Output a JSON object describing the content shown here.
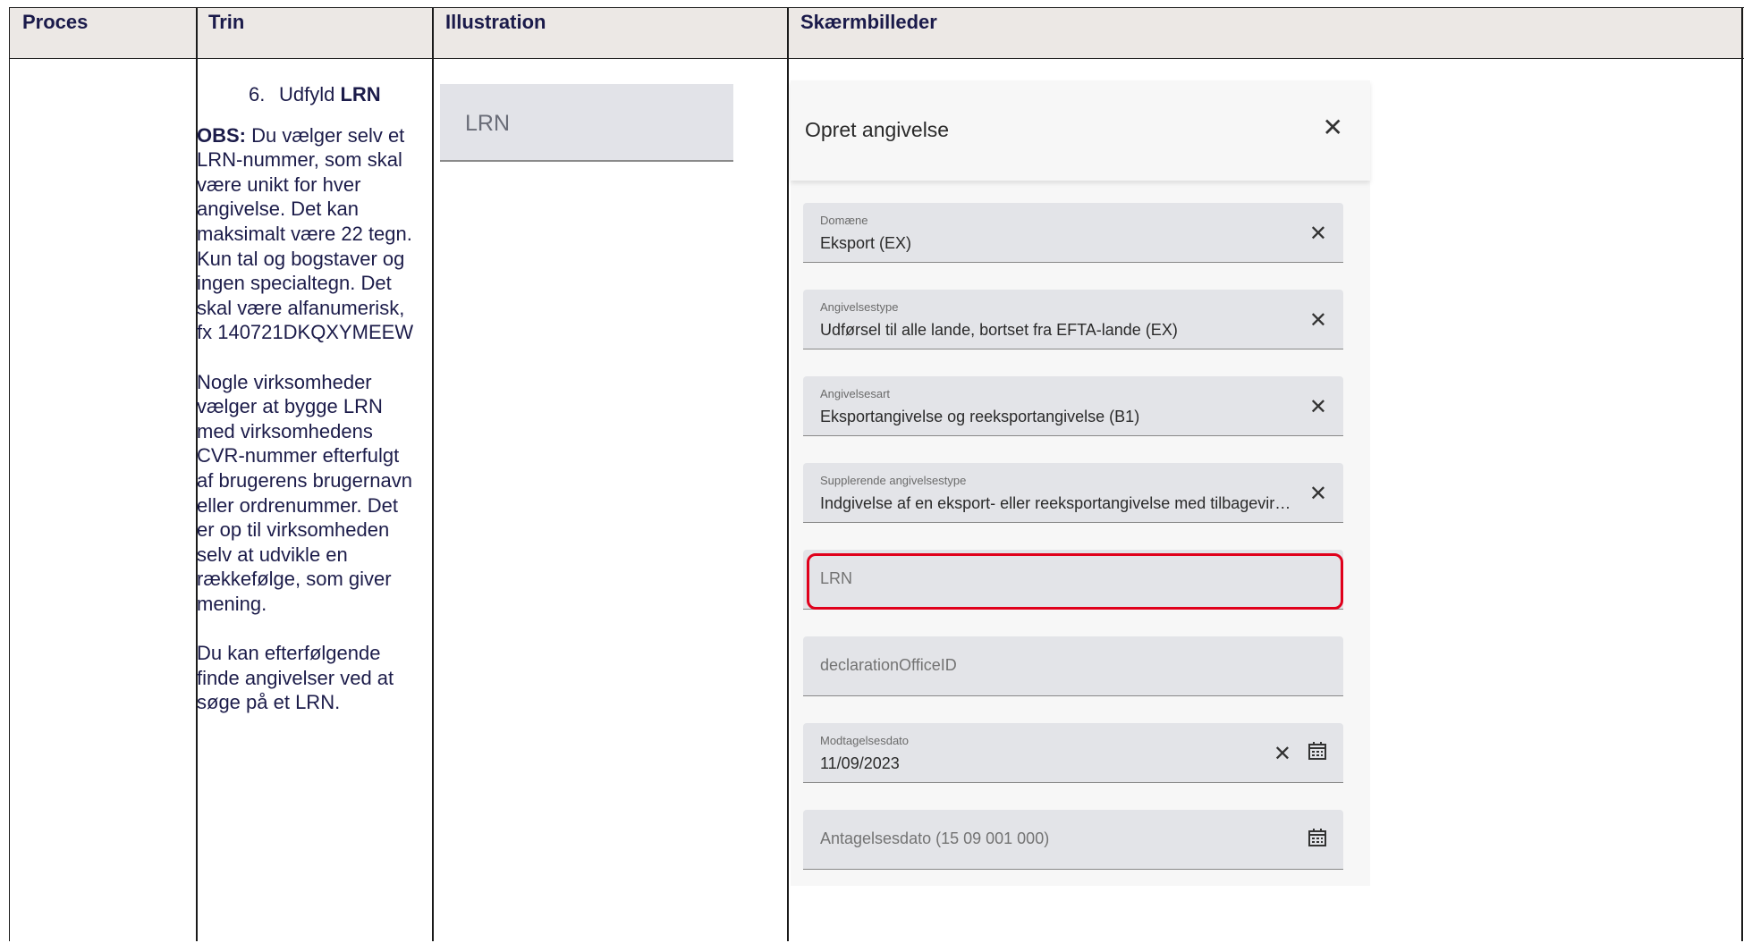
{
  "header": {
    "col_proces": "Proces",
    "col_trin": "Trin",
    "col_illustration": "Illustration",
    "col_skaermbilleder": "Skærmbilleder"
  },
  "trin": {
    "step_number": "6.",
    "step_text": "Udfyld ",
    "step_bold": "LRN",
    "obs_label": "OBS:",
    "obs_text": " Du vælger selv et LRN-nummer, som skal være unikt for hver angivelse. Det kan maksimalt være 22 tegn. Kun tal og bogstaver og ingen specialtegn. Det skal være alfanumerisk, fx 140721DKQXYMEEW",
    "paragraph2": "Nogle virksomheder vælger at bygge LRN med virksomhedens CVR-nummer efterfulgt af brugerens brugernavn eller ordrenummer. Det er op til virksomheden selv at udvikle en rækkefølge, som giver mening.",
    "paragraph3": "Du kan efterfølgende finde angivelser ved at søge på et LRN."
  },
  "illustration": {
    "field_placeholder": "LRN"
  },
  "panel": {
    "title": "Opret angivelse",
    "fields": [
      {
        "label": "Domæne",
        "value": "Eksport (EX)"
      },
      {
        "label": "Angivelsestype",
        "value": "Udførsel til alle lande, bortset fra EFTA-lande (EX)"
      },
      {
        "label": "Angivelsesart",
        "value": "Eksportangivelse og reeksportangivelse (B1)"
      },
      {
        "label": "Supplerende angivelsestype",
        "value": "Indgivelse af en eksport- eller reeksportangivelse med tilbagevirkende kraft"
      },
      {
        "placeholder": "LRN"
      },
      {
        "placeholder": "declarationOfficeID"
      },
      {
        "label": "Modtagelsesdato",
        "value": "11/09/2023"
      },
      {
        "placeholder": "Antagelsesdato (15 09 001 000)"
      }
    ]
  },
  "colors": {
    "highlight": "#e0001b",
    "header_bg": "#ece8e5"
  }
}
